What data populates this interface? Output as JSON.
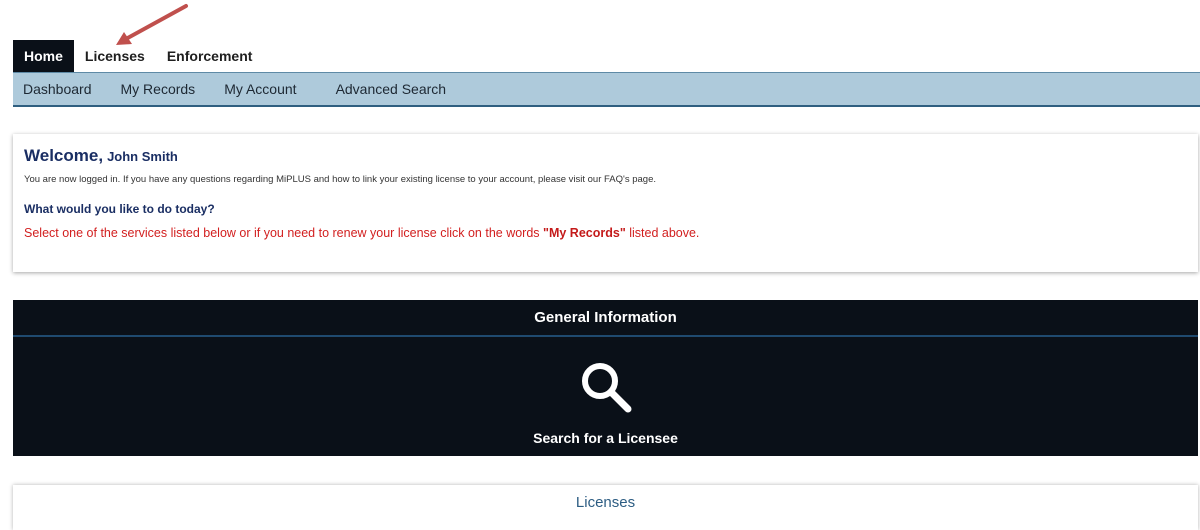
{
  "top_tabs": [
    {
      "label": "Home",
      "active": true
    },
    {
      "label": "Licenses",
      "active": false
    },
    {
      "label": "Enforcement",
      "active": false
    }
  ],
  "sub_nav": [
    "Dashboard",
    "My Records",
    "My Account",
    "Advanced Search"
  ],
  "welcome": {
    "greeting": "Welcome,",
    "user_name": "John Smith",
    "logged_in_text": "You are now logged in. If you have any questions regarding MiPLUS and how to link your existing license to your account, please visit our FAQ's page.",
    "question": "What would you like to do today?",
    "instruction_before": "Select one of the services listed below or if you need to renew your license click on the words ",
    "instruction_emphasis": "\"My Records\"",
    "instruction_after": " listed above."
  },
  "general_info": {
    "title": "General Information",
    "tile_icon": "search-icon",
    "tile_label": "Search for a Licensee"
  },
  "licenses_section": {
    "title": "Licenses"
  },
  "colors": {
    "dark_panel": "#0a1018",
    "sub_nav_bg": "#aecadb",
    "accent_navy": "#1a2e63",
    "alert_red": "#d21f1f",
    "annotation_arrow": "#c0504d"
  }
}
